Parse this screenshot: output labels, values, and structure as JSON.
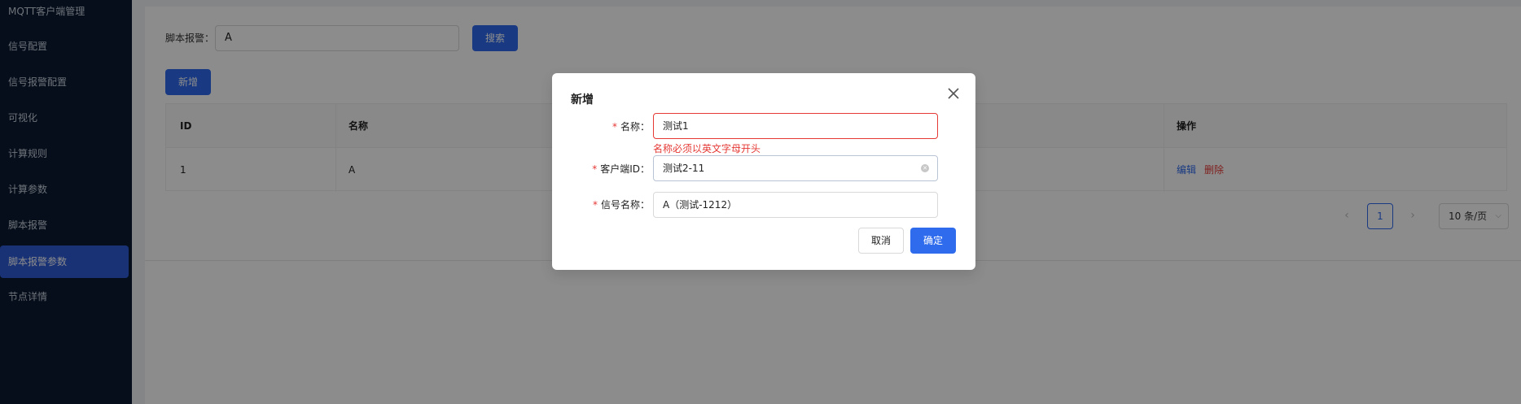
{
  "sidebar": {
    "items": [
      {
        "label": "MQTT客户端管理"
      },
      {
        "label": "信号配置"
      },
      {
        "label": "信号报警配置"
      },
      {
        "label": "可视化"
      },
      {
        "label": "计算规则"
      },
      {
        "label": "计算参数"
      },
      {
        "label": "脚本报警"
      },
      {
        "label": "脚本报警参数"
      },
      {
        "label": "节点详情"
      }
    ],
    "active_index": 7
  },
  "search": {
    "label": "脚本报警：",
    "value": "A",
    "button_label": "搜索"
  },
  "toolbar": {
    "add_label": "新增"
  },
  "table": {
    "columns": [
      "ID",
      "名称",
      "操作"
    ],
    "rows": [
      {
        "id": "1",
        "name": "A",
        "actions": [
          "编辑",
          "删除"
        ]
      }
    ]
  },
  "pagination": {
    "prev_icon": "chevron-left-icon",
    "next_icon": "chevron-right-icon",
    "current_page": "1",
    "page_size": "10 条/页"
  },
  "modal": {
    "title": "新增",
    "fields": [
      {
        "label": "名称",
        "value": "测试1",
        "required": "*",
        "error": "名称必须以英文字母开头"
      },
      {
        "label": "客户端ID",
        "value": "测试2-11",
        "required": "*"
      },
      {
        "label": "信号名称",
        "value": "A（测试-1212）",
        "required": "*"
      }
    ],
    "cancel_label": "取消",
    "ok_label": "确定"
  },
  "colors": {
    "sidebar_bg": "#0b1a33",
    "primary": "#2f6bed",
    "danger": "#e53935"
  }
}
